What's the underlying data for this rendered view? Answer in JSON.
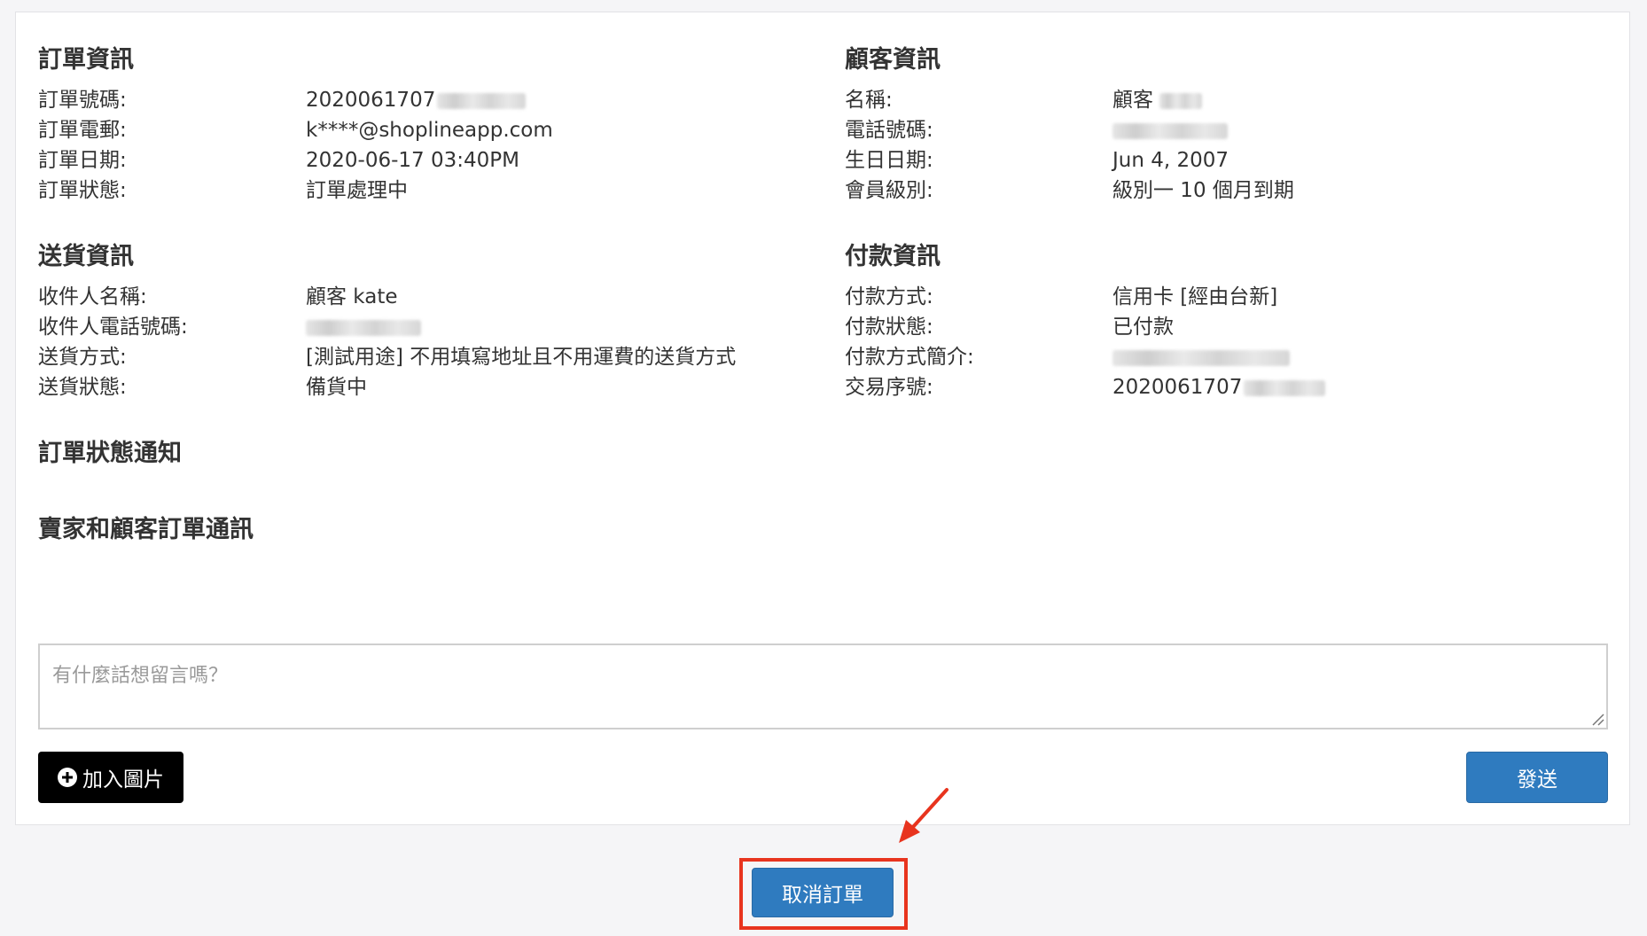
{
  "order_info": {
    "title": "訂單資訊",
    "rows": [
      {
        "label": "訂單號碼:",
        "value": "2020061707",
        "redacted": true
      },
      {
        "label": "訂單電郵:",
        "value": "k****@shoplineapp.com"
      },
      {
        "label": "訂單日期:",
        "value": "2020-06-17 03:40PM"
      },
      {
        "label": "訂單狀態:",
        "value": "訂單處理中"
      }
    ]
  },
  "customer_info": {
    "title": "顧客資訊",
    "rows": [
      {
        "label": "名稱:",
        "value": "顧客",
        "redacted": true
      },
      {
        "label": "電話號碼:",
        "value": "",
        "redacted": true
      },
      {
        "label": "生日日期:",
        "value": "Jun 4, 2007"
      },
      {
        "label": "會員級別:",
        "value": "級別一 10 個月到期"
      }
    ]
  },
  "delivery_info": {
    "title": "送貨資訊",
    "rows": [
      {
        "label": "收件人名稱:",
        "value": "顧客 kate"
      },
      {
        "label": "收件人電話號碼:",
        "value": "",
        "redacted": true
      },
      {
        "label": "送貨方式:",
        "value": "[測試用途] 不用填寫地址且不用運費的送貨方式"
      },
      {
        "label": "送貨狀態:",
        "value": "備貨中"
      }
    ]
  },
  "payment_info": {
    "title": "付款資訊",
    "rows": [
      {
        "label": "付款方式:",
        "value": "信用卡 [經由台新]"
      },
      {
        "label": "付款狀態:",
        "value": "已付款"
      },
      {
        "label": "付款方式簡介:",
        "value": "",
        "redacted": true
      },
      {
        "label": "交易序號:",
        "value": "2020061707",
        "redacted": true
      }
    ]
  },
  "order_status_notification": {
    "title": "訂單狀態通知"
  },
  "messaging": {
    "title": "賣家和顧客訂單通訊",
    "placeholder": "有什麼話想留言嗎？",
    "add_image_label": "加入圖片",
    "send_label": "發送"
  },
  "cancel_order_label": "取消訂單",
  "colors": {
    "primary_button": "#2f7bbf",
    "dark_button": "#000000",
    "annotation_red": "#e8341e",
    "page_background": "#f5f5f7"
  }
}
